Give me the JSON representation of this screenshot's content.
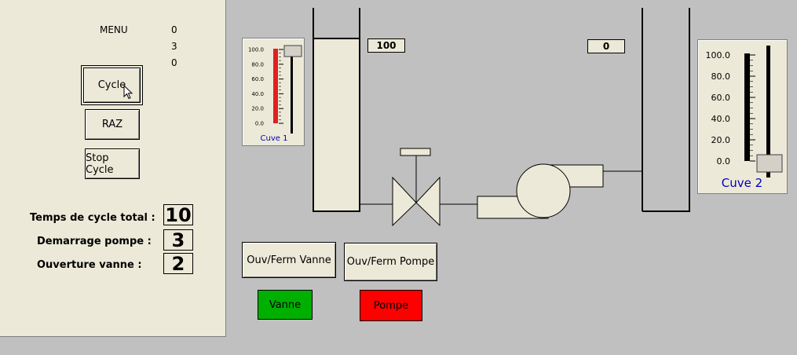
{
  "menu": {
    "label": "MENU",
    "values": [
      "0",
      "3",
      "0"
    ]
  },
  "buttons": {
    "cycle": "Cycle",
    "raz": "RAZ",
    "stop": "Stop Cycle",
    "vanne": "Ouv/Ferm Vanne",
    "pompe": "Ouv/Ferm Pompe"
  },
  "params": [
    {
      "label": "Temps de cycle total :",
      "value": "10"
    },
    {
      "label": "Demarrage pompe :",
      "value": "3"
    },
    {
      "label": "Ouverture vanne :",
      "value": "2"
    }
  ],
  "displays": {
    "tank1": "100",
    "tank2": "0"
  },
  "gauge1": {
    "name": "Cuve 1",
    "ticks": [
      "100.0",
      "80.0",
      "60.0",
      "40.0",
      "20.0",
      "0.0"
    ],
    "level_percent": 100,
    "fill_color": "#e02020"
  },
  "gauge2": {
    "name": "Cuve 2",
    "ticks": [
      "100.0",
      "80.0",
      "60.0",
      "40.0",
      "20.0",
      "0.0"
    ],
    "level_percent": 0
  },
  "indicators": {
    "vanne": {
      "label": "Vanne",
      "color": "#00b000"
    },
    "pompe": {
      "label": "Pompe",
      "color": "#ff0000"
    }
  },
  "icons": {
    "cursor": "mouse-pointer-icon",
    "valve": "valve-icon",
    "pump": "pump-icon"
  }
}
